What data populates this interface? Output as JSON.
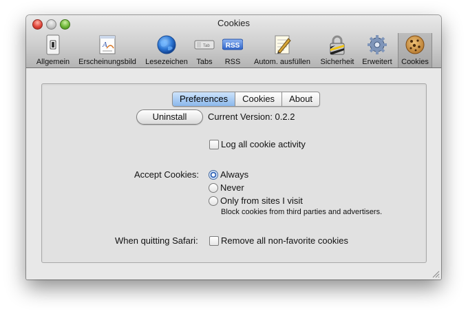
{
  "window": {
    "title": "Cookies"
  },
  "toolbar": {
    "items": [
      {
        "label": "Allgemein",
        "icon": "switch-icon"
      },
      {
        "label": "Erscheinungsbild",
        "icon": "appearance-icon"
      },
      {
        "label": "Lesezeichen",
        "icon": "globe-icon"
      },
      {
        "label": "Tabs",
        "icon": "tabs-icon"
      },
      {
        "label": "RSS",
        "icon": "rss-icon",
        "icon_text": "RSS"
      },
      {
        "label": "Autom. ausfüllen",
        "icon": "autofill-pen-icon"
      },
      {
        "label": "Sicherheit",
        "icon": "padlock-icon"
      },
      {
        "label": "Erweitert",
        "icon": "gear-icon"
      },
      {
        "label": "Cookies",
        "icon": "cookie-icon",
        "selected": true
      }
    ],
    "tabs_icon_text": "Tab"
  },
  "tabs": [
    {
      "label": "Preferences",
      "active": true
    },
    {
      "label": "Cookies",
      "active": false
    },
    {
      "label": "About",
      "active": false
    }
  ],
  "preferences": {
    "uninstall_label": "Uninstall",
    "version_text": "Current Version: 0.2.2",
    "log_label": "Log all cookie activity",
    "log_checked": false,
    "accept_label": "Accept Cookies:",
    "accept_options": [
      {
        "label": "Always",
        "selected": true
      },
      {
        "label": "Never",
        "selected": false
      },
      {
        "label": "Only from sites I visit",
        "selected": false
      }
    ],
    "accept_note": "Block cookies from third parties and advertisers.",
    "quit_label": "When quitting Safari:",
    "quit_option_label": "Remove all non-favorite cookies",
    "quit_checked": false
  },
  "colors": {
    "selected_tab": "#8bb8ec",
    "radio_on": "#2c60b5"
  }
}
